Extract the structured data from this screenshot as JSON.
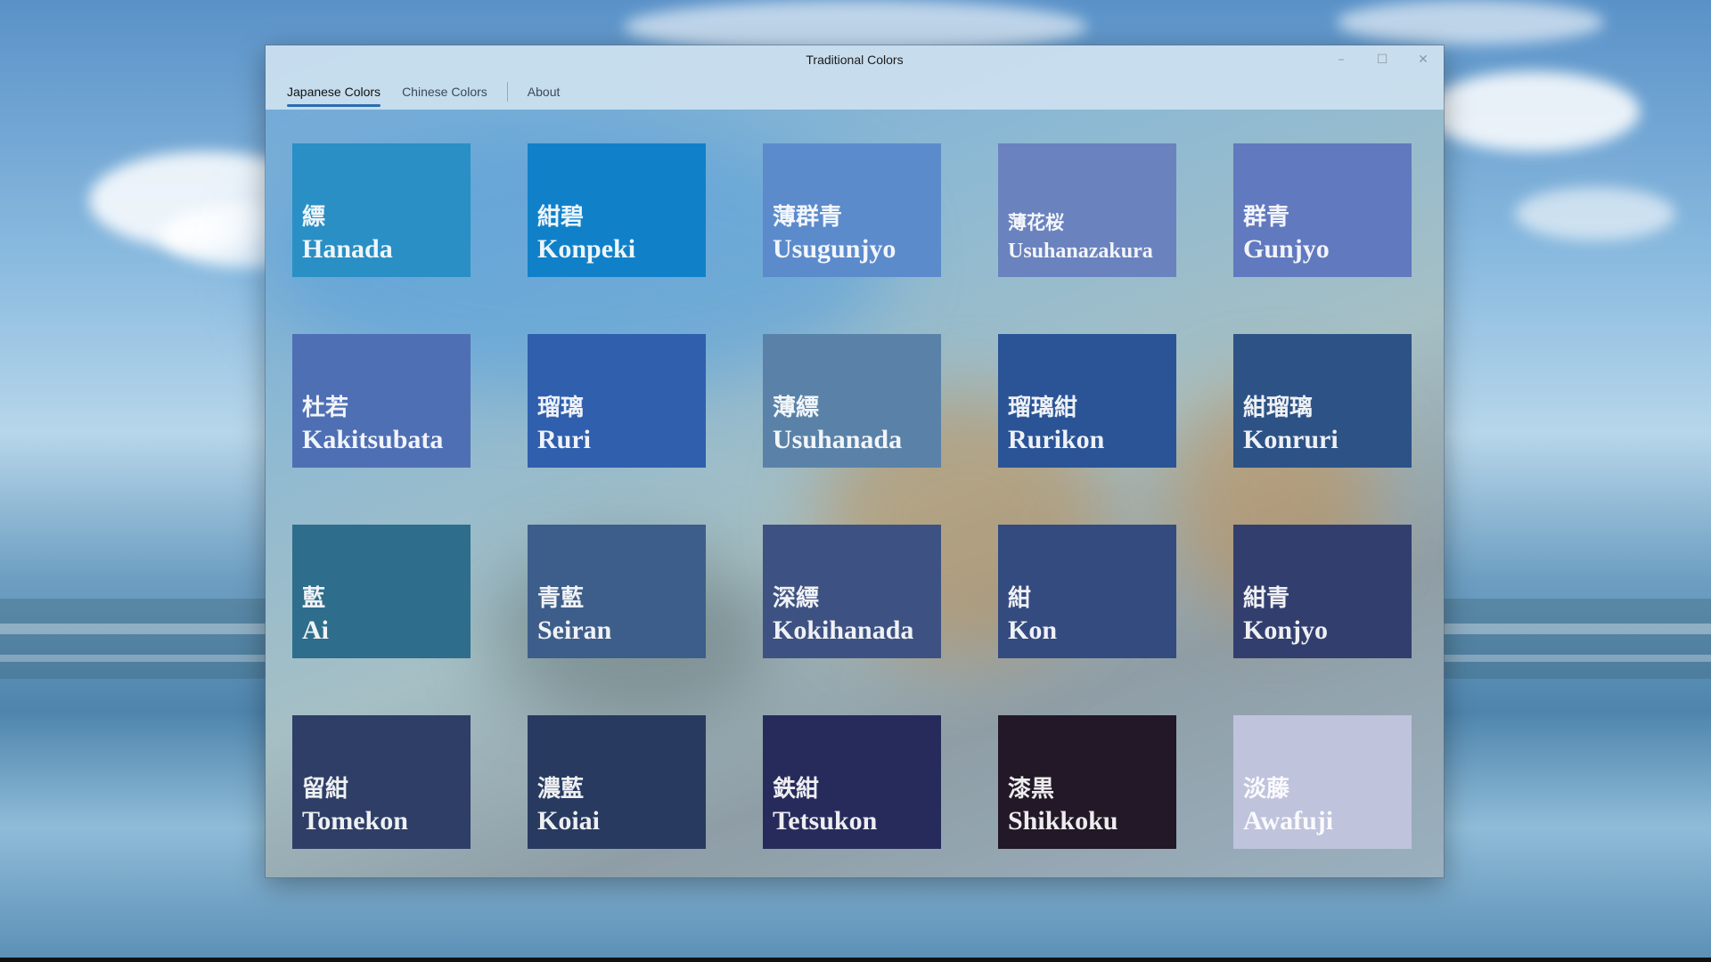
{
  "window": {
    "title": "Traditional Colors",
    "controls": {
      "minimize": "–",
      "maximize": "☐",
      "close": "✕"
    }
  },
  "nav": {
    "tabs": [
      {
        "label": "Japanese Colors",
        "active": true
      },
      {
        "label": "Chinese Colors",
        "active": false
      },
      {
        "label": "About",
        "active": false
      }
    ]
  },
  "colors": [
    {
      "kanji": "縹",
      "name": "Hanada",
      "hex": "#2a8fc4"
    },
    {
      "kanji": "紺碧",
      "name": "Konpeki",
      "hex": "#1081c8"
    },
    {
      "kanji": "薄群青",
      "name": "Usugunjyo",
      "hex": "#5c8bcc"
    },
    {
      "kanji": "薄花桜",
      "name": "Usuhanazakura",
      "hex": "#6a83bf"
    },
    {
      "kanji": "群青",
      "name": "Gunjyo",
      "hex": "#6179be"
    },
    {
      "kanji": "杜若",
      "name": "Kakitsubata",
      "hex": "#4f6fb4"
    },
    {
      "kanji": "瑠璃",
      "name": "Ruri",
      "hex": "#2f5fad"
    },
    {
      "kanji": "薄縹",
      "name": "Usuhanada",
      "hex": "#5a82a8"
    },
    {
      "kanji": "瑠璃紺",
      "name": "Rurikon",
      "hex": "#2b5496"
    },
    {
      "kanji": "紺瑠璃",
      "name": "Konruri",
      "hex": "#2d5286"
    },
    {
      "kanji": "藍",
      "name": "Ai",
      "hex": "#2e6d8c"
    },
    {
      "kanji": "青藍",
      "name": "Seiran",
      "hex": "#3d5e8a"
    },
    {
      "kanji": "深縹",
      "name": "Kokihanada",
      "hex": "#3d5282"
    },
    {
      "kanji": "紺",
      "name": "Kon",
      "hex": "#344b80"
    },
    {
      "kanji": "紺青",
      "name": "Konjyo",
      "hex": "#323f6e"
    },
    {
      "kanji": "留紺",
      "name": "Tomekon",
      "hex": "#2e3e66"
    },
    {
      "kanji": "濃藍",
      "name": "Koiai",
      "hex": "#283a60"
    },
    {
      "kanji": "鉄紺",
      "name": "Tetsukon",
      "hex": "#272b5c"
    },
    {
      "kanji": "漆黒",
      "name": "Shikkoku",
      "hex": "#221827"
    },
    {
      "kanji": "淡藤",
      "name": "Awafuji",
      "hex": "#bfc3dc"
    }
  ]
}
